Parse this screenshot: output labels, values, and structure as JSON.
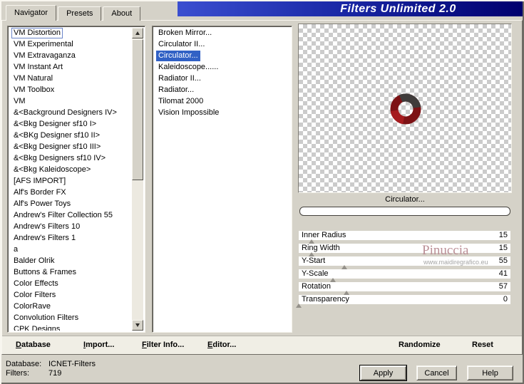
{
  "title_banner": "Filters Unlimited 2.0",
  "tabs": [
    {
      "label": "Navigator",
      "active": true
    },
    {
      "label": "Presets",
      "active": false
    },
    {
      "label": "About",
      "active": false
    }
  ],
  "categories": {
    "selected": "VM Distortion",
    "items": [
      "VM Distortion",
      "VM Experimental",
      "VM Extravaganza",
      "VM Instant Art",
      "VM Natural",
      "VM Toolbox",
      "VM",
      "&<Background Designers IV>",
      "&<Bkg Designer sf10 I>",
      "&<BKg Designer sf10 II>",
      "&<Bkg Designer sf10 III>",
      "&<Bkg Designers sf10 IV>",
      "&<Bkg Kaleidoscope>",
      "[AFS IMPORT]",
      "Alf's Border FX",
      "Alf's Power Toys",
      "Andrew's Filter Collection 55",
      "Andrew's Filters 10",
      "Andrew's Filters 1",
      "a",
      "Balder Olrik",
      "Buttons & Frames",
      "Color Effects",
      "Color Filters",
      "ColorRave",
      "Convolution Filters",
      "CPK Designs"
    ]
  },
  "filters": {
    "selected": "Circulator...",
    "items": [
      "Broken Mirror...",
      "Circulator II...",
      "Circulator...",
      "Kaleidoscope......",
      "Radiator II...",
      "Radiator...",
      "Tilomat 2000",
      "Vision Impossible"
    ]
  },
  "preview": {
    "selected_filter_label": "Circulator...",
    "ring_colors": {
      "main": "#7d1215",
      "shade": "#3f3b3a",
      "light": "#a51b1e"
    }
  },
  "parameters": [
    {
      "name": "Inner Radius",
      "value": 15
    },
    {
      "name": "Ring Width",
      "value": 15
    },
    {
      "name": "Y-Start",
      "value": 55
    },
    {
      "name": "Y-Scale",
      "value": 41
    },
    {
      "name": "Rotation",
      "value": 57
    },
    {
      "name": "Transparency",
      "value": 0
    }
  ],
  "watermark": {
    "name": "Pinuccia",
    "site": "www.maidiregrafico.eu"
  },
  "toolbar": {
    "database": "Database",
    "import": "Import...",
    "filter_info": "Filter Info...",
    "editor": "Editor...",
    "randomize": "Randomize",
    "reset": "Reset"
  },
  "status": {
    "database_label": "Database:",
    "database_value": "ICNET-Filters",
    "filters_label": "Filters:",
    "filters_value": "719"
  },
  "action_buttons": {
    "apply": "Apply",
    "cancel": "Cancel",
    "help": "Help"
  },
  "colors": {
    "selection": "#3161c5",
    "banner_start": "#3b4fd0",
    "banner_end": "#00006e",
    "dialog_bg": "#d5d2c8"
  }
}
